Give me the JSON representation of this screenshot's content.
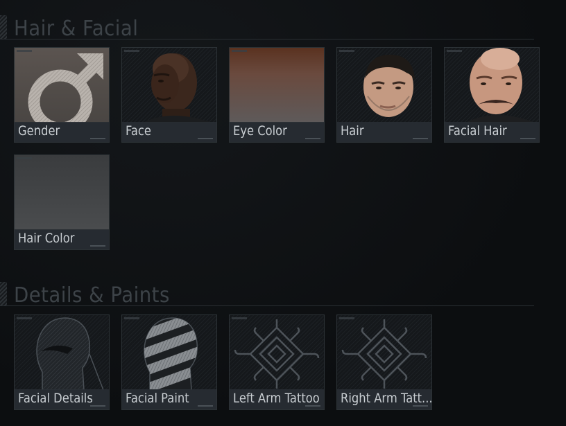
{
  "sections": {
    "hair_facial": {
      "title": "Hair & Facial"
    },
    "details_paints": {
      "title": "Details & Paints"
    }
  },
  "tiles": {
    "gender": {
      "label": "Gender",
      "icon": "male-symbol-icon"
    },
    "face": {
      "label": "Face",
      "icon": "face-portrait-icon"
    },
    "eye_color": {
      "label": "Eye Color",
      "icon": "color-swatch-icon"
    },
    "hair": {
      "label": "Hair",
      "icon": "hair-portrait-icon"
    },
    "facial_hair": {
      "label": "Facial Hair",
      "icon": "mustache-portrait-icon"
    },
    "hair_color": {
      "label": "Hair Color",
      "icon": "color-swatch-icon"
    },
    "facial_details": {
      "label": "Facial Details",
      "icon": "head-outline-icon"
    },
    "facial_paint": {
      "label": "Facial Paint",
      "icon": "striped-head-icon"
    },
    "left_arm_tattoo": {
      "label": "Left Arm Tattoo",
      "icon": "tribal-emblem-icon"
    },
    "right_arm_tattoo": {
      "label": "Right Arm Tatt...",
      "icon": "tribal-emblem-icon"
    }
  },
  "colors": {
    "background": "#0d0f11",
    "section_title": "#3d4348",
    "tile_label": "#c9ced2",
    "tile_border": "#2c3236",
    "eye_color_swatch": "#6a4a3e",
    "hair_color_swatch": "#474a4c"
  }
}
